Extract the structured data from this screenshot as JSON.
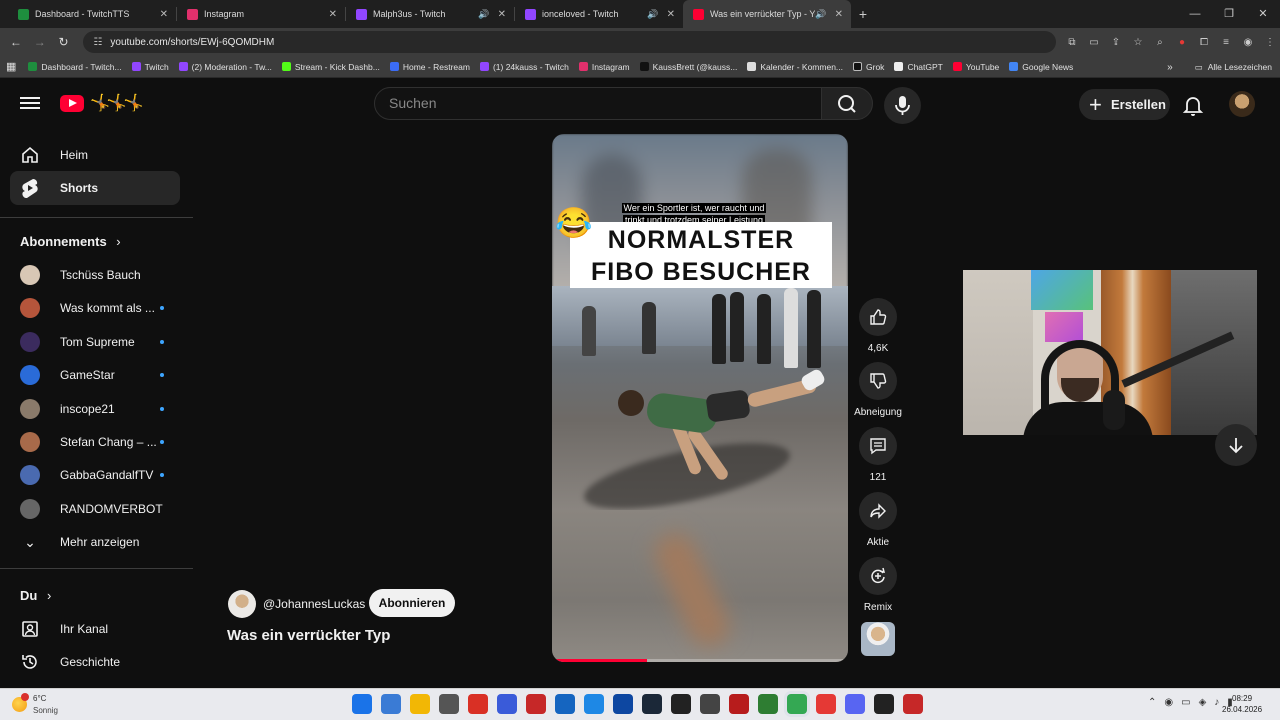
{
  "browser": {
    "tabs": [
      {
        "title": "Dashboard - TwitchTTS",
        "color": "#1e8e3e",
        "sound": false
      },
      {
        "title": "Instagram",
        "color": "#e1306c",
        "sound": false
      },
      {
        "title": "Malph3us - Twitch",
        "color": "#9146ff",
        "sound": true
      },
      {
        "title": "ionceloved - Twitch",
        "color": "#9146ff",
        "sound": true
      },
      {
        "title": "Was ein verrückter Typ - Yo",
        "color": "#ff0033",
        "sound": true
      }
    ],
    "url": "youtube.com/shorts/EWj-6QOMDHM",
    "bookmarks": [
      {
        "label": "Dashboard - Twitch...",
        "color": "#1e8e3e"
      },
      {
        "label": "Twitch",
        "color": "#9146ff"
      },
      {
        "label": "(2) Moderation - Tw...",
        "color": "#9146ff"
      },
      {
        "label": "Stream - Kick Dashb...",
        "color": "#53fc18"
      },
      {
        "label": "Home - Restream",
        "color": "#3b6cf5"
      },
      {
        "label": "(1) 24kauss - Twitch",
        "color": "#9146ff"
      },
      {
        "label": "Instagram",
        "color": "#e1306c"
      },
      {
        "label": "KaussBrett (@kauss...",
        "color": "#111111"
      },
      {
        "label": "Kalender - Kommen...",
        "color": "#dddddd"
      },
      {
        "label": "Grok",
        "color": "#111111"
      },
      {
        "label": "ChatGPT",
        "color": "#eeeeee"
      },
      {
        "label": "YouTube",
        "color": "#ff0033"
      },
      {
        "label": "Google News",
        "color": "#4285f4"
      }
    ],
    "all_bookmarks": "Alle Lesezeichen"
  },
  "header": {
    "search_placeholder": "Suchen",
    "create_label": "Erstellen"
  },
  "sidebar": {
    "home": "Heim",
    "shorts": "Shorts",
    "subscriptions_heading": "Abonnements",
    "subscriptions": [
      {
        "name": "Tschüss Bauch",
        "new": false,
        "color": "#d8c7b5"
      },
      {
        "name": "Was kommt als ...",
        "new": true,
        "color": "#b5553b"
      },
      {
        "name": "Tom Supreme",
        "new": false,
        "color": "#3b2b5e"
      },
      {
        "name": "GameStar",
        "new": true,
        "color": "#2a6bd8"
      },
      {
        "name": "inscope21",
        "new": true,
        "color": "#8a7a6a"
      },
      {
        "name": "Stefan Chang – ...",
        "new": true,
        "color": "#a86a4a"
      },
      {
        "name": "GabbaGandalfTV",
        "new": true,
        "color": "#4a6ab0"
      },
      {
        "name": "RANDOMVERBOT",
        "new": false,
        "color": "#666666"
      }
    ],
    "show_more": "Mehr anzeigen",
    "you_heading": "Du",
    "your_channel": "Ihr Kanal",
    "history": "Geschichte"
  },
  "short": {
    "overlay_small_line1": "Wer ein Sportler ist, wer raucht und",
    "overlay_small_line2": "trinkt und trotzdem seiner Leistung",
    "overlay_big_line1": "NORMALSTER",
    "overlay_big_line2": "FIBO BESUCHER",
    "emoji": "😂",
    "progress": 0.32,
    "channel": "@JohannesLuckas",
    "subscribe_label": "Abonnieren",
    "title": "Was ein verrückter Typ"
  },
  "actions": {
    "like_count": "4,6K",
    "dislike_label": "Abneigung",
    "comment_count": "121",
    "share_label": "Aktie",
    "remix_label": "Remix"
  },
  "taskbar": {
    "temperature": "6°C",
    "weather": "Sonnig",
    "time": "08:29",
    "date": "26.04.2026",
    "apps": [
      "#1a73e8",
      "#3a7bd5",
      "#f2b705",
      "#555555",
      "#d93025",
      "#3a5bd9",
      "#c62828",
      "#1565c0",
      "#1e88e5",
      "#0d47a1",
      "#1b2838",
      "#222222",
      "#444444",
      "#b71c1c",
      "#2e7d32",
      "#34a853",
      "#e53935",
      "#5865f2",
      "#222222",
      "#c62828"
    ]
  }
}
